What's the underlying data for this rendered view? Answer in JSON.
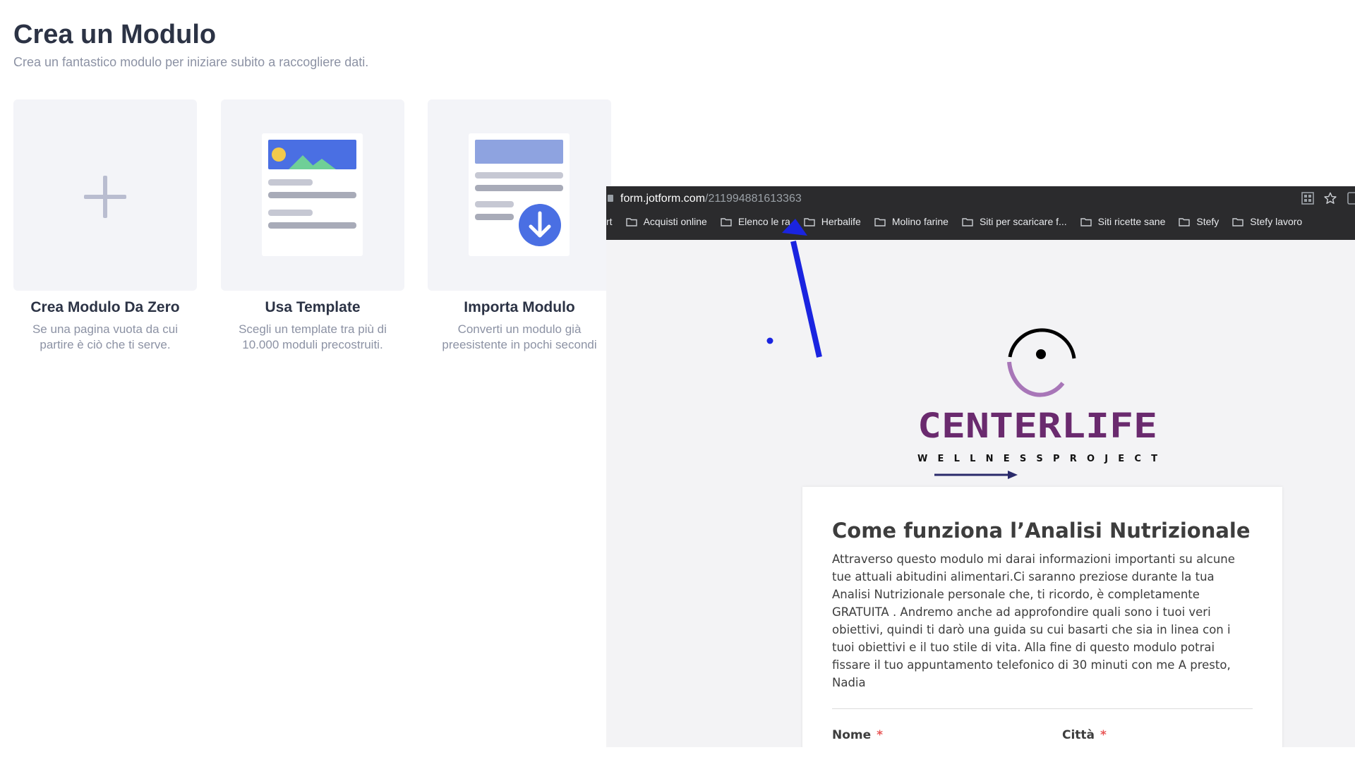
{
  "header": {
    "title": "Crea un Modulo",
    "subtitle": "Crea un fantastico modulo per iniziare subito a raccogliere dati."
  },
  "cards": [
    {
      "title": "Crea Modulo Da Zero",
      "desc_line1": "Se una pagina vuota da cui",
      "desc_line2": "partire è ciò che ti serve.",
      "icon": "plus-icon"
    },
    {
      "title": "Usa Template",
      "desc_line1": "Scegli un template tra più di",
      "desc_line2": "10.000 moduli precostruiti.",
      "icon": "template-document-icon"
    },
    {
      "title": "Importa Modulo",
      "desc_line1": "Converti un modulo già",
      "desc_line2": "preesistente in pochi secondi",
      "icon": "import-document-icon"
    }
  ],
  "browser": {
    "url_domain": "form.jotform.com",
    "url_path": "/211994881613363",
    "bookmarks": [
      "rt",
      "Acquisti online",
      "Elenco le  ra",
      "Herbalife",
      "Molino farine",
      "Siti per scaricare f...",
      "Siti ricette sane",
      "Stefy",
      "Stefy lavoro"
    ]
  },
  "logo": {
    "name": "CENTERLIFE",
    "tagline": "WELLNESS PROJECT"
  },
  "form": {
    "heading": "Come funziona l’Analisi Nutrizionale",
    "body_lines": [
      "Attraverso questo modulo mi darai informazioni importanti su alcune",
      "tue attuali abitudini alimentari.Ci saranno preziose durante la tua",
      "Analisi Nutrizionale personale che, ti ricordo, è completamente",
      "GRATUITA . Andremo anche ad approfondire quali sono i tuoi veri",
      "obiettivi, quindi ti darò una guida su cui basarti che sia in linea con i",
      "tuoi obiettivi e il tuo stile di vita. Alla fine di questo modulo potrai",
      "fissare il tuo appuntamento telefonico di 30 minuti con me A presto,",
      "Nadia"
    ],
    "field_nome": "Nome",
    "field_citta": "Città",
    "required_mark": "*"
  },
  "colors": {
    "annotation_arrow": "#1a24e0",
    "brand_purple": "#6a2a6e",
    "accent_blue": "#4a6fe3"
  }
}
